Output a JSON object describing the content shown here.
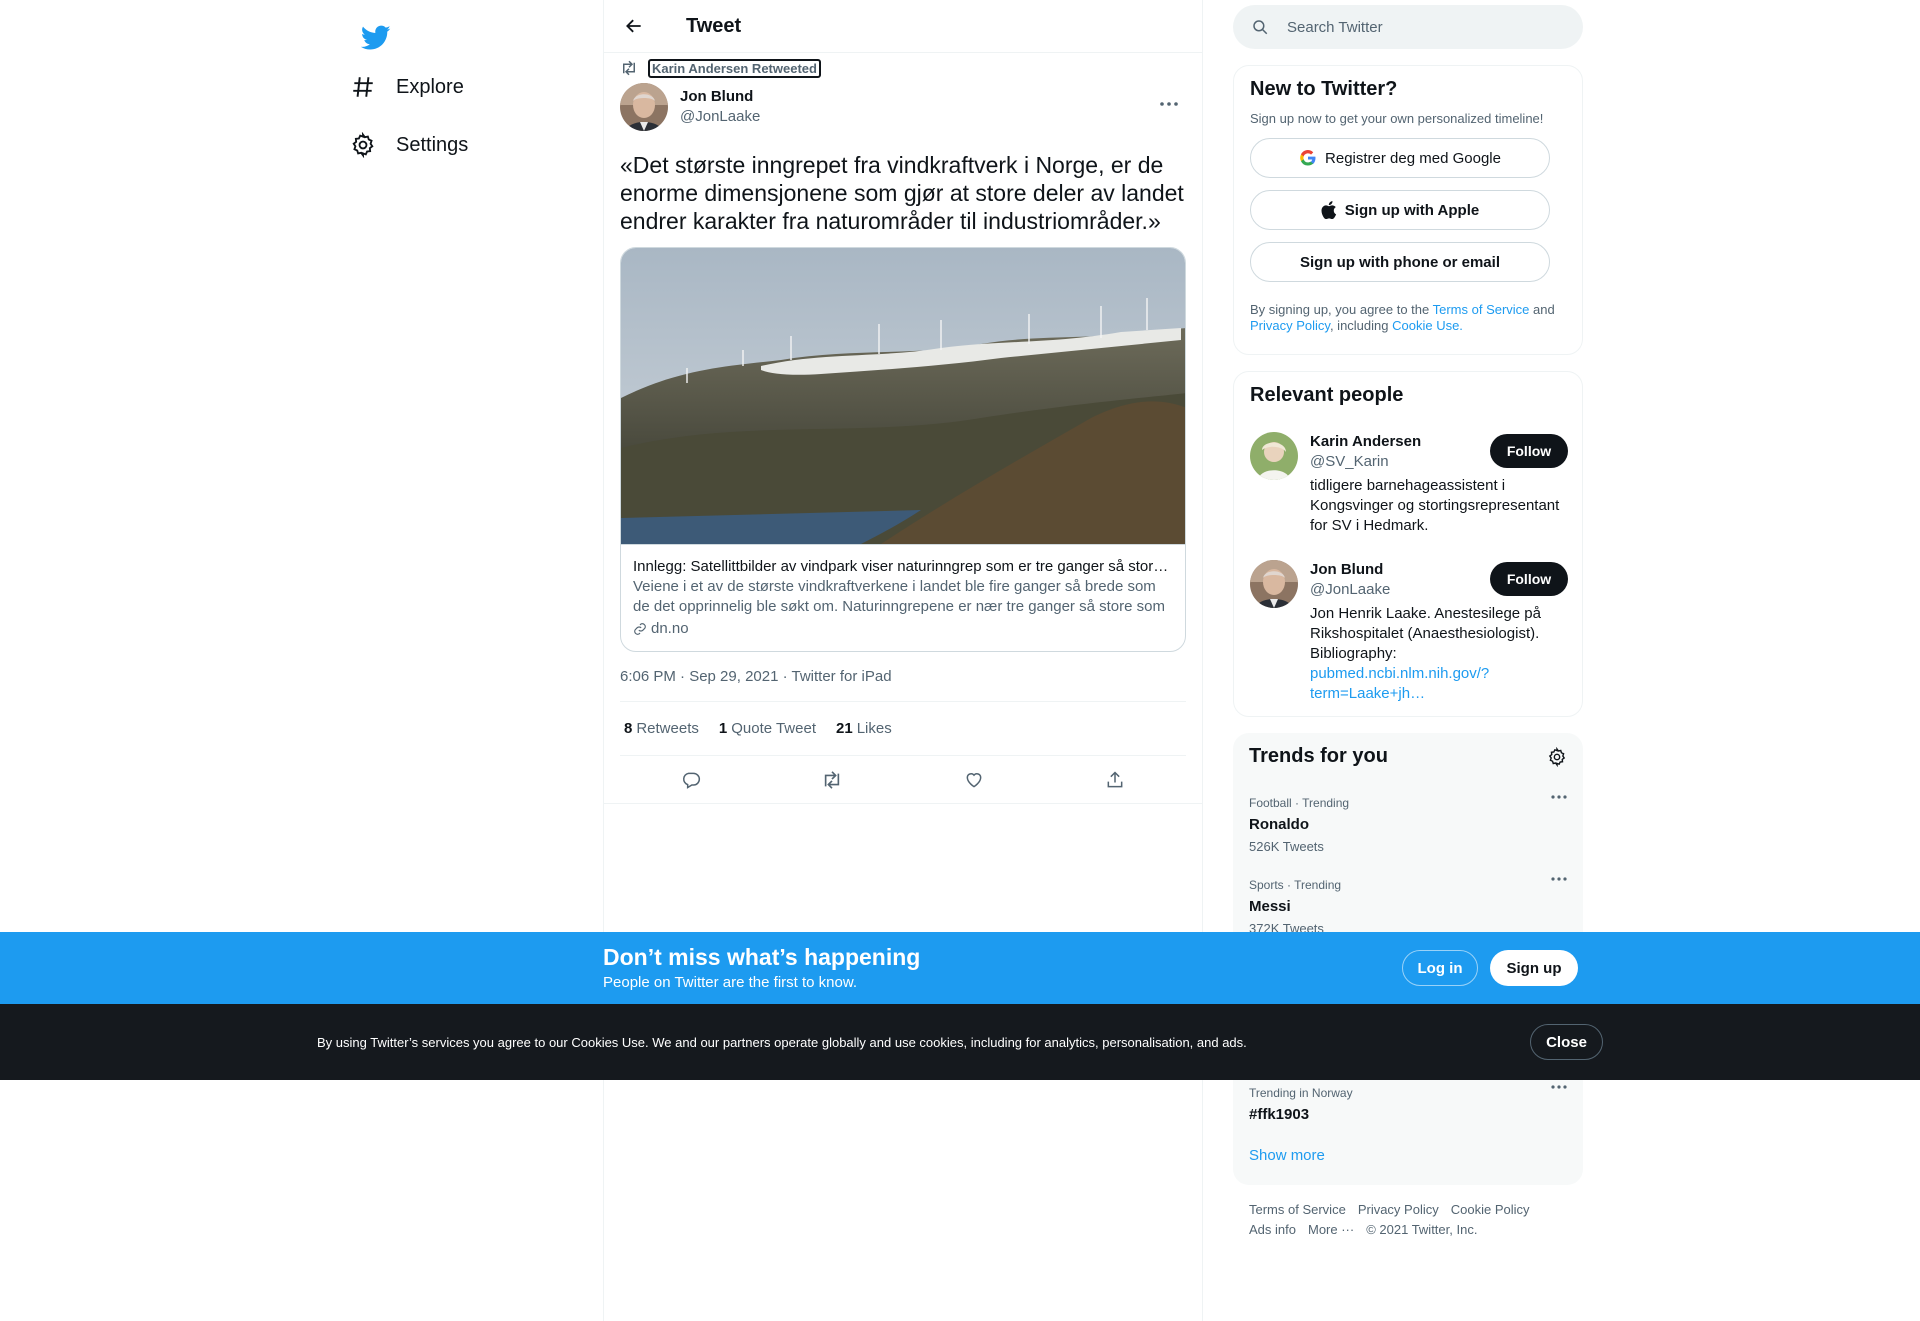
{
  "nav": {
    "logo": "twitter-bird-icon",
    "items": [
      {
        "label": "Explore",
        "icon": "hashtag-icon"
      },
      {
        "label": "Settings",
        "icon": "gear-icon"
      }
    ]
  },
  "header": {
    "title": "Tweet",
    "back_icon": "arrow-left-icon"
  },
  "tweet": {
    "retweeted_by": "Karin Andersen Retweeted",
    "author_name": "Jon Blund",
    "author_handle": "@JonLaake",
    "text": "«Det største inngrepet fra vindkraftverk i Norge, er de enorme dimensjonene som gjør at store deler av landet endrer karakter fra naturområder til industriområder.»",
    "card": {
      "title": "Innlegg: Satellittbilder av vindpark viser naturinngrep som er tre ganger så store som søkt om",
      "description": "Veiene i et av de største vindkraftverkene i landet ble fire ganger så brede som de det opprinnelig ble søkt om. Naturinngrepene er nær tre ganger så store som det som ble søkt om.",
      "domain": "dn.no"
    },
    "timestamp": "6:06 PM · Sep 29, 2021 · Twitter for iPad",
    "stats": {
      "retweets": "8",
      "retweets_label": "Retweets",
      "quotes": "1",
      "quotes_label": "Quote Tweet",
      "likes": "21",
      "likes_label": "Likes"
    }
  },
  "search": {
    "placeholder": "Search Twitter"
  },
  "new_to_twitter": {
    "title": "New to Twitter?",
    "subtitle": "Sign up now to get your own personalized timeline!",
    "google_btn": "Registrer deg med Google",
    "apple_btn": "Sign up with Apple",
    "phone_btn": "Sign up with phone or email",
    "legal_1": "By signing up, you agree to the ",
    "terms": "Terms of Service",
    "legal_2": " and ",
    "privacy": "Privacy Policy",
    "legal_3": ", including ",
    "cookie": "Cookie Use."
  },
  "relevant_people": {
    "title": "Relevant people",
    "people": [
      {
        "name": "Karin Andersen",
        "handle": "@SV_Karin",
        "bio": "tidligere barnehageassistent i Kongsvinger og stortingsrepresentant for SV i Hedmark.",
        "follow": "Follow"
      },
      {
        "name": "Jon Blund",
        "handle": "@JonLaake",
        "bio": "Jon Henrik Laake. Anestesilege på Rikshospitalet (Anaesthesiologist). Bibliography:",
        "link": "pubmed.ncbi.nlm.nih.gov/?term=Laake+jh…",
        "follow": "Follow"
      }
    ]
  },
  "trends": {
    "title": "Trends for you",
    "items": [
      {
        "meta": "Football · Trending",
        "name": "Ronaldo",
        "count": "526K Tweets"
      },
      {
        "meta": "Sports · Trending",
        "name": "Messi",
        "count": "372K Tweets"
      },
      {
        "meta": "Trending in Norway",
        "name": "#ffk1903",
        "count": ""
      }
    ],
    "show_more": "Show more"
  },
  "footer": {
    "links": [
      "Terms of Service",
      "Privacy Policy",
      "Cookie Policy",
      "Ads info",
      "More ···",
      "© 2021 Twitter, Inc."
    ]
  },
  "banner": {
    "title": "Don’t miss what’s happening",
    "subtitle": "People on Twitter are the first to know.",
    "login": "Log in",
    "signup": "Sign up"
  },
  "cookies": {
    "text": "By using Twitter’s services you agree to our Cookies Use. We and our partners operate globally and use cookies, including for analytics, personalisation, and ads.",
    "close": "Close"
  },
  "colors": {
    "accent": "#1d9bf0",
    "text": "#0f1419",
    "secondary": "#536471",
    "cookie_bg": "#15191e"
  }
}
